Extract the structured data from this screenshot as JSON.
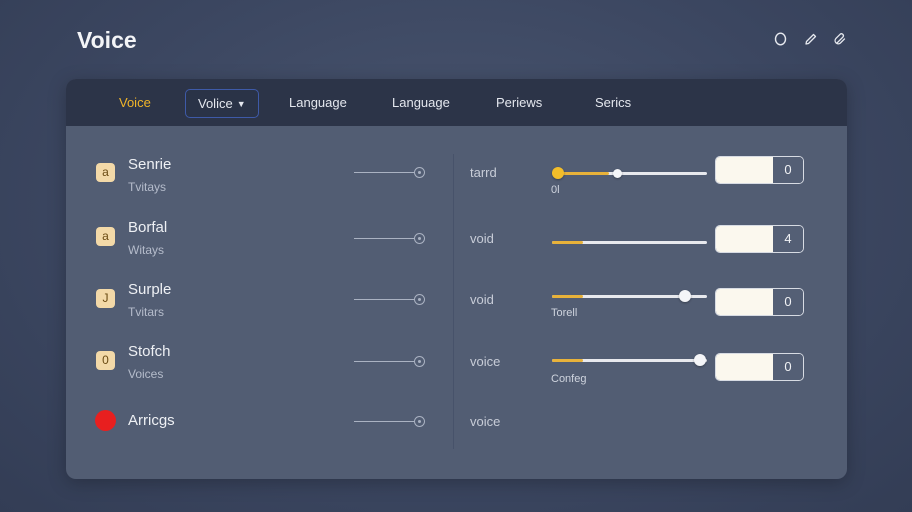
{
  "header": {
    "title": "Voice"
  },
  "top_icons": [
    "circle-icon",
    "pencil-icon",
    "paperclip-icon"
  ],
  "tabs": [
    {
      "label": "Voice",
      "active": true
    },
    {
      "label": "Volice",
      "dropdown": true
    },
    {
      "label": "Language"
    },
    {
      "label": "Language"
    },
    {
      "label": "Periews"
    },
    {
      "label": "Serics"
    }
  ],
  "rows": [
    {
      "badge": "a",
      "name": "Senrie",
      "sub": "Tvitays",
      "mid": "tarrd",
      "slider_fill": 0.05,
      "slider_knob": 0.42,
      "under": "0l",
      "value": "0"
    },
    {
      "badge": "a",
      "name": "Borfal",
      "sub": "Witays",
      "mid": "void",
      "slider_fill": 0.2,
      "value": "4"
    },
    {
      "badge": "J",
      "name": "Surple",
      "sub": "Tvitars",
      "mid": "void",
      "slider_fill": 0.2,
      "slider_knob": 0.86,
      "under": "Torell",
      "value": "0"
    },
    {
      "badge": "0",
      "name": "Stofch",
      "sub": "Voices",
      "mid": "voice",
      "slider_fill": 0.2,
      "slider_knob": 0.96,
      "under": "Confeg",
      "value": "0"
    },
    {
      "badge": "",
      "name": "Arricgs",
      "sub": "",
      "mid": "voice"
    }
  ],
  "colors": {
    "accent": "#f0b429",
    "badge_bg": "#f3d9a8",
    "record_red": "#e81f1f"
  }
}
